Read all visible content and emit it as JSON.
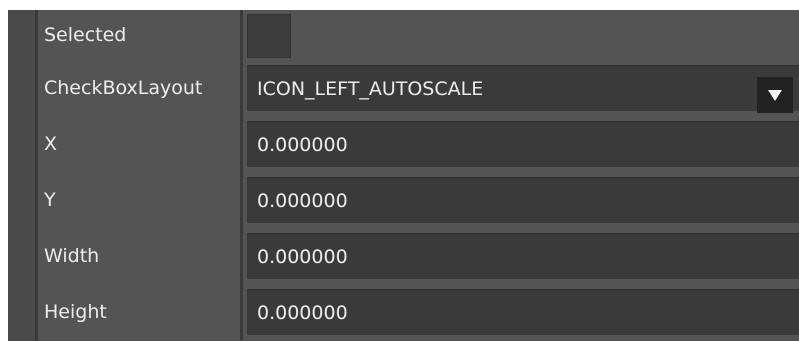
{
  "properties": [
    {
      "label": "Selected",
      "type": "checkbox",
      "checked": false
    },
    {
      "label": "CheckBoxLayout",
      "type": "dropdown",
      "value": "ICON_LEFT_AUTOSCALE"
    },
    {
      "label": "X",
      "type": "text",
      "value": "0.000000"
    },
    {
      "label": "Y",
      "type": "text",
      "value": "0.000000"
    },
    {
      "label": "Width",
      "type": "text",
      "value": "0.000000"
    },
    {
      "label": "Height",
      "type": "text",
      "value": "0.000000"
    }
  ],
  "icons": {
    "dropdown": "chevron-down-icon"
  },
  "colors": {
    "panel_bg": "#545454",
    "field_bg": "#3a3a3a",
    "text": "#ececec",
    "dropdown_btn": "#222222"
  }
}
